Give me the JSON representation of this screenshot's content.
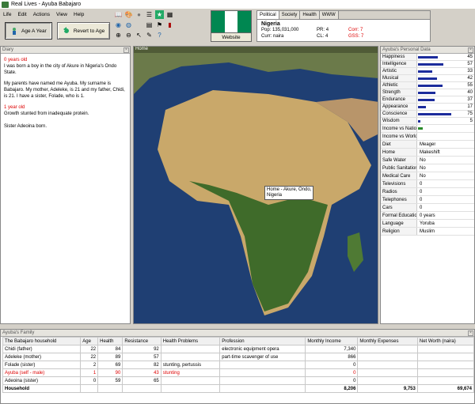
{
  "window": {
    "title": "Real Lives - Ayuba Babajaro"
  },
  "menu": [
    "Life",
    "Edit",
    "Actions",
    "View",
    "Help"
  ],
  "toolbar": {
    "age_button": "Age A Year",
    "revert_button": "Revert to Age",
    "website_button": "Website"
  },
  "flag": {
    "colors": [
      "#008751",
      "#ffffff",
      "#008751"
    ]
  },
  "country": {
    "tabs": [
      "Political",
      "Society",
      "Health",
      "WWW"
    ],
    "name": "Nigeria",
    "pop_label": "Pop:",
    "pop": "135,031,000",
    "curr_label": "Curr:",
    "curr": "naira",
    "pr_label": "PR:",
    "pr": "4",
    "cl_label": "CL:",
    "cl": "4",
    "corr_label": "Corr:",
    "corr": "7",
    "gss_label": "GSS:",
    "gss": "7"
  },
  "diary": {
    "title": "Diary",
    "entries": [
      {
        "age": "0 years old",
        "paras": [
          "I was born a boy in the city of Akure in Nigeria's Ondo State.",
          "My parents have named me Ayuba. My surname is Babajaro. My mother, Adeleke, is 21 and my father, Chidi, is 21. I have a sister, Folade, who is 1."
        ]
      },
      {
        "age": "1 year old",
        "paras": [
          "Growth stunted from inadequate protein.",
          "Sister Adeoina born."
        ]
      }
    ]
  },
  "map": {
    "title": "Home",
    "tooltip": "Home - Akure, Ondo,\nNigeria"
  },
  "personal": {
    "title": "Ayuba's Personal Data",
    "stats": [
      {
        "label": "Happiness",
        "value": 45
      },
      {
        "label": "Intelligence",
        "value": 57
      },
      {
        "label": "Artistic",
        "value": 33
      },
      {
        "label": "Musical",
        "value": 42
      },
      {
        "label": "Athletic",
        "value": 55
      },
      {
        "label": "Strength",
        "value": 40
      },
      {
        "label": "Endurance",
        "value": 37
      },
      {
        "label": "Appearance",
        "value": 17
      },
      {
        "label": "Conscience",
        "value": 75
      },
      {
        "label": "Wisdom",
        "value": 5
      }
    ],
    "income_labels": [
      "Income vs Nation",
      "Income vs World"
    ],
    "info": [
      {
        "label": "Diet",
        "value": "Meager"
      },
      {
        "label": "Home",
        "value": "Makeshift"
      },
      {
        "label": "Safe Water",
        "value": "No"
      },
      {
        "label": "Public Sanitation",
        "value": "No"
      },
      {
        "label": "Medical Care",
        "value": "No"
      },
      {
        "label": "Televisions",
        "value": "0"
      },
      {
        "label": "Radios",
        "value": "0"
      },
      {
        "label": "Telephones",
        "value": "0"
      },
      {
        "label": "Cars",
        "value": "0"
      },
      {
        "label": "Formal Education",
        "value": "0 years"
      },
      {
        "label": "Language",
        "value": "Yoruba"
      },
      {
        "label": "Religion",
        "value": "Muslim"
      }
    ]
  },
  "family": {
    "title": "Ayuba's Family",
    "headers": [
      "The Babajaro household",
      "Age",
      "Health",
      "Resistance",
      "Health Problems",
      "Profession",
      "Monthly Income",
      "Monthly Expenses",
      "Net Worth (naira)"
    ],
    "rows": [
      [
        "Chidi (father)",
        "22",
        "84",
        "92",
        "",
        "electronic equipment opera",
        "7,340",
        "",
        ""
      ],
      [
        "Adeleke (mother)",
        "22",
        "89",
        "57",
        "",
        "part-time scavenger of use",
        "866",
        "",
        ""
      ],
      [
        "Folade (sister)",
        "2",
        "69",
        "82",
        "stunting, pertussis",
        "",
        "0",
        "",
        ""
      ],
      [
        "Ayuba (self - male)",
        "1",
        "90",
        "43",
        "stunting",
        "",
        "0",
        "",
        ""
      ],
      [
        "Adeoina (sister)",
        "0",
        "59",
        "65",
        "",
        "",
        "0",
        "",
        ""
      ],
      [
        "Household",
        "",
        "",
        "",
        "",
        "",
        "8,206",
        "9,753",
        "69,674"
      ]
    ]
  }
}
